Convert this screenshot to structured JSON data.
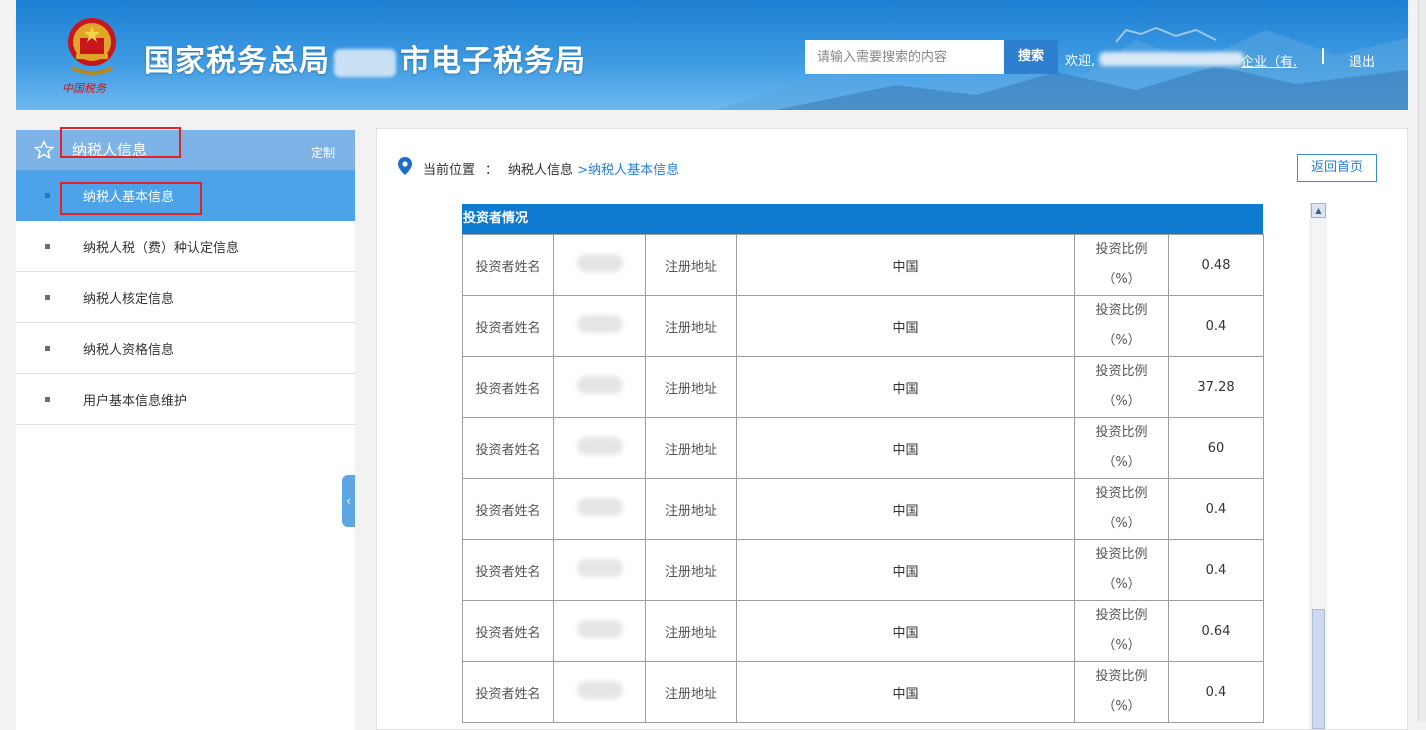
{
  "header": {
    "title_part1": "国家税务总局",
    "title_part2": "市电子税务局",
    "emblem_caption": "中国税务",
    "search_placeholder": "请输入需要搜索的内容",
    "search_button": "搜索",
    "welcome": "欢迎,",
    "company": "企业（有.",
    "logout": "退出"
  },
  "sidebar": {
    "title": "纳税人信息",
    "customize": "定制",
    "items": [
      {
        "label": "纳税人基本信息",
        "active": true
      },
      {
        "label": "纳税人税（费）种认定信息"
      },
      {
        "label": "纳税人核定信息"
      },
      {
        "label": "纳税人资格信息"
      },
      {
        "label": "用户基本信息维护"
      }
    ]
  },
  "breadcrumb": {
    "prefix": "当前位置",
    "colon": "：",
    "level1": "纳税人信息",
    "current": ">纳税人基本信息"
  },
  "home_button": "返回首页",
  "section_title": "投资者情况",
  "table": {
    "name_label": "投资者姓名",
    "address_label": "注册地址",
    "ratio_label_line1": "投资比例",
    "ratio_label_line2": "（%）",
    "rows": [
      {
        "address": "中国",
        "ratio": "0.48"
      },
      {
        "address": "中国",
        "ratio": "0.4"
      },
      {
        "address": "中国",
        "ratio": "37.28"
      },
      {
        "address": "中国",
        "ratio": "60"
      },
      {
        "address": "中国",
        "ratio": "0.4"
      },
      {
        "address": "中国",
        "ratio": "0.4"
      },
      {
        "address": "中国",
        "ratio": "0.64"
      },
      {
        "address": "中国",
        "ratio": "0.4"
      }
    ]
  },
  "colors": {
    "header_blue": "#1d7fd2",
    "sidebar_active": "#4da3ea",
    "section_blue": "#0e7ad0",
    "highlight_red": "#e02424"
  }
}
